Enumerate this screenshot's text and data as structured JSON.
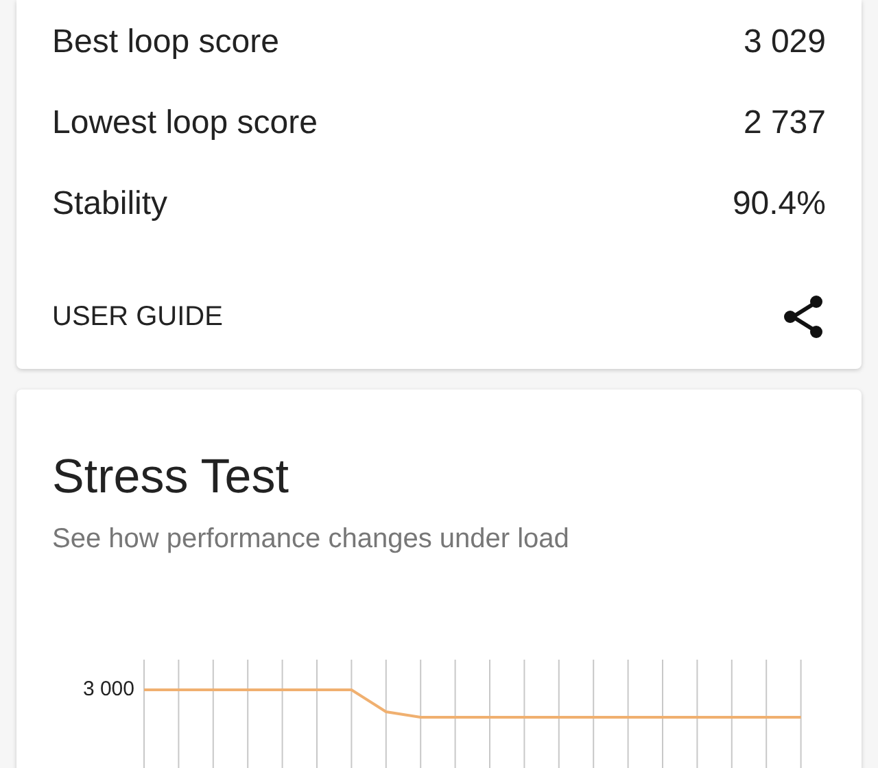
{
  "score_card": {
    "rows": [
      {
        "label": "Best loop score",
        "value": "3 029"
      },
      {
        "label": "Lowest loop score",
        "value": "2 737"
      },
      {
        "label": "Stability",
        "value": "90.4%"
      }
    ],
    "user_guide": "USER GUIDE"
  },
  "stress_test": {
    "title": "Stress Test",
    "subtitle": "See how performance changes under load",
    "y_tick": "3 000"
  }
}
